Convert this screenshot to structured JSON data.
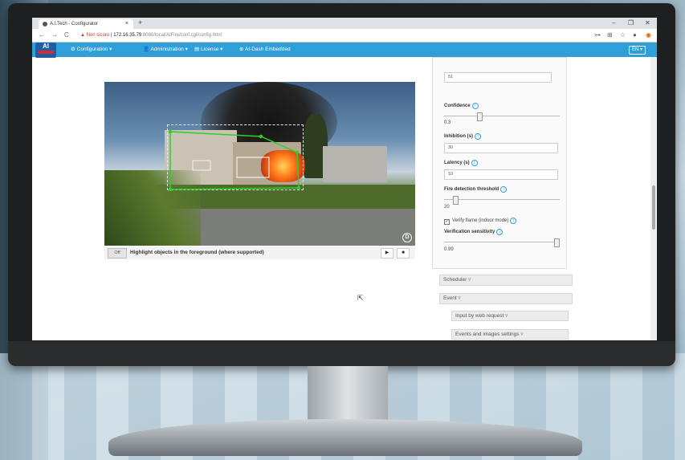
{
  "browser": {
    "tab_title": "A.I.Tech - Configurator",
    "tab_close": "×",
    "new_tab": "+",
    "window_controls": [
      "–",
      "❐",
      "✕"
    ],
    "nav": {
      "back": "←",
      "forward": "→",
      "reload": "C"
    },
    "address": {
      "warning": "▲ Non sicuro",
      "host": "172.16.35.79",
      "path": ":8080/local/AIFire/conf.cgi/config.html"
    }
  },
  "app": {
    "logo_text": "AI",
    "menu": [
      {
        "label": "⚙ Configuration ▾"
      },
      {
        "label": "👤 Administration ▾"
      },
      {
        "label": "▤ License ▾"
      },
      {
        "label": "⊕ AI-Dash Embedded"
      }
    ],
    "language": "EN ▾"
  },
  "video": {
    "badge": "D",
    "highlight_toggle": "Off",
    "highlight_label": "Highlight objects in the foreground (where supported)",
    "play": "▶",
    "stop": "■"
  },
  "settings": {
    "top_value": "51",
    "confidence_label": "Confidence",
    "confidence_value": "0.3",
    "confidence_level": 0.3,
    "inhibition_label": "Inhibition (s)",
    "inhibition_value": "30",
    "latency_label": "Latency (s)",
    "latency_value": "10",
    "fire_threshold_label": "Fire detection threshold",
    "fire_threshold_value": "20",
    "fire_threshold_level": 0.08,
    "verify_flame_label": "Verify flame (indoor mode)",
    "verify_flame_checked": true,
    "verification_label": "Verification sensitivity",
    "verification_value": "0.99",
    "verification_level": 0.99,
    "info_icon": "i"
  },
  "sections": {
    "scheduler": "Scheduler ▿",
    "event": "Event ▿",
    "input_web": "Input by web request ▿",
    "events_images": "Events and images settings ▿"
  },
  "colors": {
    "navbar": "#2f9fd8",
    "roi": "#2bd12b",
    "detection": "#ffffff"
  }
}
